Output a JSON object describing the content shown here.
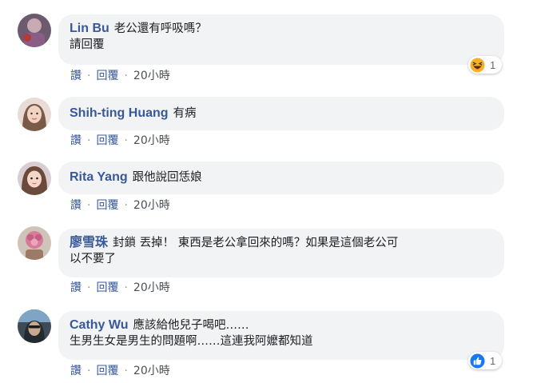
{
  "comments": [
    {
      "author": "Lin Bu",
      "text_line1": "老公還有呼吸嗎？",
      "text_line2": "請回覆",
      "actions": {
        "like": "讚",
        "reply": "回覆",
        "time": "20小時"
      },
      "reaction": {
        "icon": "haha-icon",
        "count": "1"
      }
    },
    {
      "author": "Shih-ting Huang",
      "text_line1": "有病",
      "actions": {
        "like": "讚",
        "reply": "回覆",
        "time": "20小時"
      }
    },
    {
      "author": "Rita Yang",
      "text_line1": "跟他說回恁娘",
      "actions": {
        "like": "讚",
        "reply": "回覆",
        "time": "20小時"
      }
    },
    {
      "author": "廖雪珠",
      "text_line1": "封鎖 丟掉！ 東西是老公拿回來的嗎？如果是這個老公可",
      "text_line2": "以不要了",
      "actions": {
        "like": "讚",
        "reply": "回覆",
        "time": "20小時"
      }
    },
    {
      "author": "Cathy Wu",
      "text_line1": "應該給他兒子喝吧……",
      "text_line2": "生男生女是男生的問題啊……這連我阿嬤都知道",
      "actions": {
        "like": "讚",
        "reply": "回覆",
        "time": "20小時"
      },
      "reaction": {
        "icon": "like-icon",
        "count": "1"
      }
    }
  ],
  "colors": {
    "author": "#385898",
    "bubble": "#f2f3f5",
    "like_blue": "#1877f2",
    "haha_yellow": "#f7b125"
  }
}
